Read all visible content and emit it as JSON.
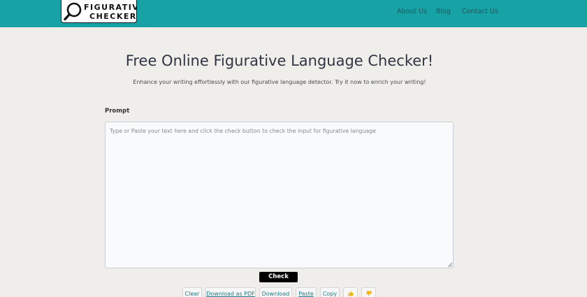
{
  "header": {
    "logo_line1": "FIGURATIVE",
    "logo_line2": "CHECKER",
    "nav": {
      "about": "About Us",
      "blog": "Blog",
      "contact": "Contact Us"
    },
    "bar_color": "#17a3a5"
  },
  "main": {
    "title": "Free Online Figurative Language Checker!",
    "subtitle": "Enhance your writing effortlessly with our figurative language detector. Try it now to enrich your writing!",
    "prompt_label": "Prompt",
    "textarea_value": "",
    "textarea_placeholder": "Type or Paste your text here and click the check button to check the input for figurative language",
    "check_label": "Check"
  },
  "toolbar": {
    "clear": "Clear",
    "download_pdf": "Download as PDF",
    "download": "Download",
    "paste": "Paste",
    "copy": "Copy",
    "thumbs_up_icon": "thumbs-up-icon",
    "thumbs_down_icon": "thumbs-down-icon"
  }
}
